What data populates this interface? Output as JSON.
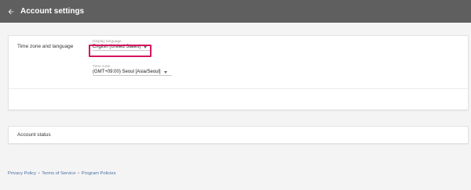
{
  "header": {
    "title": "Account settings",
    "back_icon": "arrow-back-icon",
    "background_color": "#5f5f5f"
  },
  "settings_card": {
    "section_label": "Time zone and language",
    "display_language": {
      "caption": "Display language",
      "value": "English (United States)"
    },
    "time_zone": {
      "caption": "Time zone",
      "value": "(GMT+09:00) Seoul [Asia/Seoul]"
    },
    "highlight_color": "#d6155f"
  },
  "status_card": {
    "label": "Account status"
  },
  "footer": {
    "links": [
      "Privacy Policy",
      "Terms of Service",
      "Program Policies"
    ],
    "separator": "•",
    "link_color": "#4a6fa5"
  }
}
